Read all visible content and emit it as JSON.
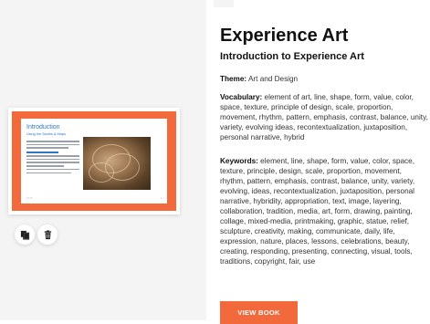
{
  "book": {
    "title": "Experience Art",
    "subtitle": "Introduction to Experience Art",
    "theme_label": "Theme:",
    "theme_value": "Art and Design",
    "vocab_label": "Vocabulary:",
    "vocab_value": "element of art, line, shape, form, value, color, space, texture, principle of design, scale, proportion, movement, rhythm, pattern, emphasis, contrast, balance, unity, variety, evolving ideas, recontextualization, juxtaposition, personal narrative, hybrid",
    "keywords_label": "Keywords:",
    "keywords_lines": [
      "element, line, shape, form, value, color, space,",
      "texture, principle, design, scale, proportion, movement,",
      "rhythm, pattern, emphasis, contrast, balance, unity, variety,",
      "evolving, ideas, recontextualization, juxtaposition, personal",
      "narrative, hybridity, appropriation, text, image, layering,",
      "collaboration, tradition, media, art, form, drawing, painting,",
      "collage, mixed-media, printmaking, graphic, statue, relief,",
      "sculpture, creativity, making, communicate, daily, life,",
      "expression, nature, places, lessons, celebrations, beauty,",
      "creating, responding, presenting, connecting, visual, tools,",
      "traditions, copyright, fair, use"
    ],
    "view_button": "VIEW BOOK"
  },
  "thumbnail": {
    "heading": "Introduction",
    "subheading": "Using the Stories & Maps"
  },
  "actions": {
    "copy_icon": "copy-icon",
    "delete_icon": "trash-icon"
  },
  "colors": {
    "accent": "#f26a3c",
    "thumbnail_blue": "#2f77c4"
  }
}
